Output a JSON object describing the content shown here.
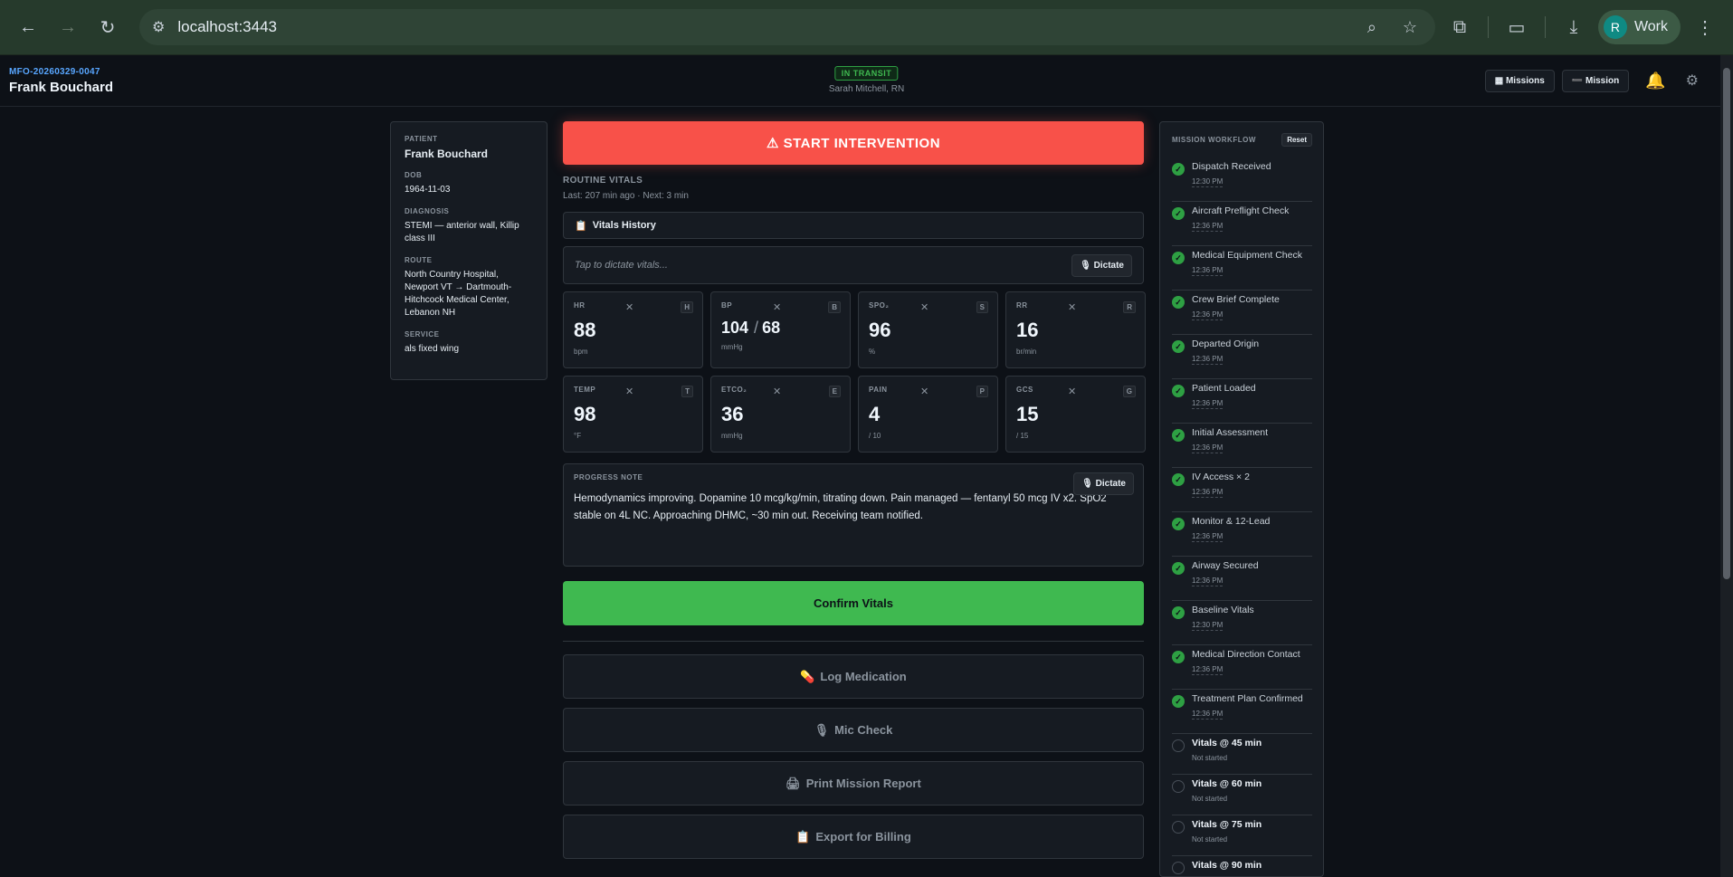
{
  "browser": {
    "url": "localhost:3443",
    "profile_initial": "R",
    "profile_label": "Work"
  },
  "header": {
    "mission_id": "MFO-20260329-0047",
    "patient_name": "Frank Bouchard",
    "status": "IN TRANSIT",
    "crew": "Sarah Mitchell, RN",
    "missions_btn": "Missions",
    "mission_btn": "Mission"
  },
  "patient": {
    "patient_label": "PATIENT",
    "name": "Frank Bouchard",
    "dob_label": "DOB",
    "dob": "1964-11-03",
    "diagnosis_label": "DIAGNOSIS",
    "diagnosis": "STEMI — anterior wall, Killip class III",
    "route_label": "ROUTE",
    "route": "North Country Hospital, Newport VT → Dartmouth-Hitchcock Medical Center, Lebanon NH",
    "service_label": "SERVICE",
    "service": "als fixed wing"
  },
  "main": {
    "start_intervention": "START INTERVENTION",
    "routine_label": "ROUTINE VITALS",
    "routine_last": "Last: 207 min ago",
    "routine_next": "Next: 3 min",
    "vitals_history": "Vitals History",
    "dictate_placeholder": "Tap to dictate vitals...",
    "dictate_btn": "Dictate",
    "vitals": [
      {
        "label": "HR",
        "value": "88",
        "unit": "bpm",
        "key": "H"
      },
      {
        "label": "BP",
        "value": "104",
        "value2": "68",
        "unit": "mmHg",
        "key": "B"
      },
      {
        "label": "SPO₂",
        "value": "96",
        "unit": "%",
        "key": "S"
      },
      {
        "label": "RR",
        "value": "16",
        "unit": "br/min",
        "key": "R"
      },
      {
        "label": "TEMP",
        "value": "98",
        "unit": "°F",
        "key": "T"
      },
      {
        "label": "ETCO₂",
        "value": "36",
        "unit": "mmHg",
        "key": "E"
      },
      {
        "label": "PAIN",
        "value": "4",
        "unit": "/ 10",
        "key": "P"
      },
      {
        "label": "GCS",
        "value": "15",
        "unit": "/ 15",
        "key": "G"
      }
    ],
    "progress_label": "PROGRESS NOTE",
    "progress_dictate": "Dictate",
    "progress_text": "Hemodynamics improving. Dopamine 10 mcg/kg/min, titrating down. Pain managed — fentanyl 50 mcg IV x2. SpO2 stable on 4L NC. Approaching DHMC, ~30 min out. Receiving team notified.",
    "confirm": "Confirm Vitals",
    "log_med": "Log Medication",
    "mic_check": "Mic Check",
    "print_report": "Print Mission Report",
    "export_billing": "Export for Billing"
  },
  "workflow": {
    "title": "MISSION WORKFLOW",
    "reset": "Reset",
    "steps": [
      {
        "label": "Dispatch Received",
        "sub": "12:30 PM",
        "done": true
      },
      {
        "label": "Aircraft Preflight Check",
        "sub": "12:36 PM",
        "done": true
      },
      {
        "label": "Medical Equipment Check",
        "sub": "12:36 PM",
        "done": true
      },
      {
        "label": "Crew Brief Complete",
        "sub": "12:36 PM",
        "done": true
      },
      {
        "label": "Departed Origin",
        "sub": "12:36 PM",
        "done": true
      },
      {
        "label": "Patient Loaded",
        "sub": "12:36 PM",
        "done": true
      },
      {
        "label": "Initial Assessment",
        "sub": "12:36 PM",
        "done": true
      },
      {
        "label": "IV Access × 2",
        "sub": "12:36 PM",
        "done": true
      },
      {
        "label": "Monitor & 12-Lead",
        "sub": "12:36 PM",
        "done": true
      },
      {
        "label": "Airway Secured",
        "sub": "12:36 PM",
        "done": true
      },
      {
        "label": "Baseline Vitals",
        "sub": "12:30 PM",
        "done": true
      },
      {
        "label": "Medical Direction Contact",
        "sub": "12:36 PM",
        "done": true
      },
      {
        "label": "Treatment Plan Confirmed",
        "sub": "12:36 PM",
        "done": true
      },
      {
        "label": "Vitals @ 45 min",
        "sub": "Not started",
        "done": false
      },
      {
        "label": "Vitals @ 60 min",
        "sub": "Not started",
        "done": false
      },
      {
        "label": "Vitals @ 75 min",
        "sub": "Not started",
        "done": false
      },
      {
        "label": "Vitals @ 90 min",
        "sub": "",
        "done": false
      }
    ]
  }
}
